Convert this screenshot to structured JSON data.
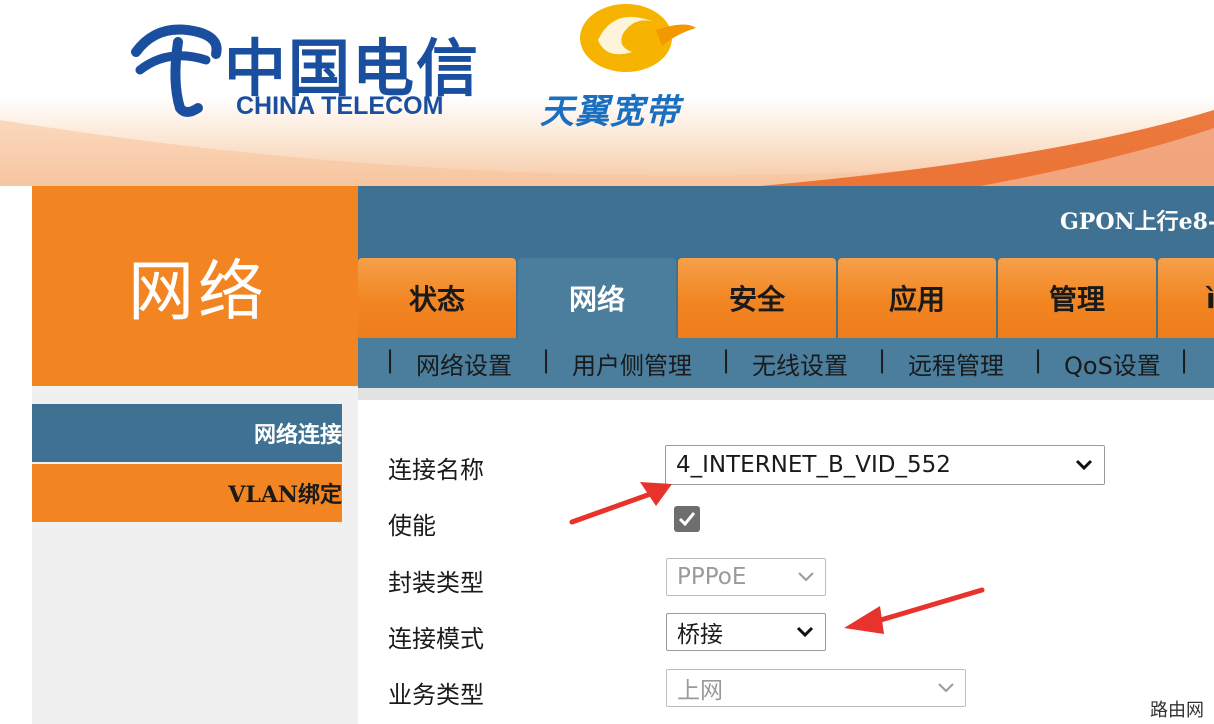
{
  "brand": {
    "china_telecom_cn": "中国电信",
    "china_telecom_en": "CHINA TELECOM",
    "tianyi": "天翼宽带"
  },
  "section_title": "网络",
  "topbar_text": "GPON上行e8-",
  "tabs": [
    {
      "label": "状态",
      "active": false
    },
    {
      "label": "网络",
      "active": true
    },
    {
      "label": "安全",
      "active": false
    },
    {
      "label": "应用",
      "active": false
    },
    {
      "label": "管理",
      "active": false
    },
    {
      "label": "ì",
      "active": false
    }
  ],
  "subnav": [
    "网络设置",
    "用户侧管理",
    "无线设置",
    "远程管理",
    "QoS设置"
  ],
  "sidebar": {
    "items": [
      {
        "label": "网络连接",
        "active": true
      },
      {
        "label": "VLAN绑定",
        "active": false
      }
    ]
  },
  "form": {
    "connection_name": {
      "label": "连接名称",
      "value": "4_INTERNET_B_VID_552"
    },
    "enable": {
      "label": "使能",
      "checked": true
    },
    "encapsulation": {
      "label": "封装类型",
      "value": "PPPoE"
    },
    "connection_mode": {
      "label": "连接模式",
      "value": "桥接"
    },
    "service_type": {
      "label": "业务类型",
      "value": "上网"
    }
  },
  "watermark": "路由网",
  "colors": {
    "orange": "#f28521",
    "steel_blue": "#3f7292",
    "annotation_red": "#e8322c"
  }
}
